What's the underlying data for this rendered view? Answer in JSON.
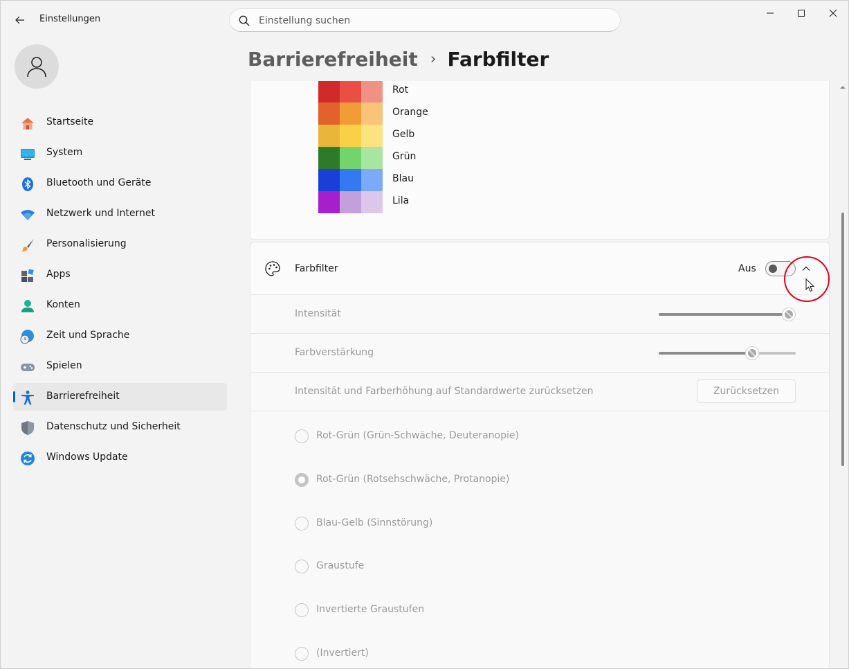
{
  "app": {
    "title": "Einstellungen"
  },
  "search": {
    "placeholder": "Einstellung suchen"
  },
  "sidebar": {
    "items": [
      {
        "label": "Startseite",
        "icon": "home-icon"
      },
      {
        "label": "System",
        "icon": "monitor-icon"
      },
      {
        "label": "Bluetooth und Geräte",
        "icon": "bluetooth-icon"
      },
      {
        "label": "Netzwerk und Internet",
        "icon": "wifi-icon"
      },
      {
        "label": "Personalisierung",
        "icon": "brush-icon"
      },
      {
        "label": "Apps",
        "icon": "apps-icon"
      },
      {
        "label": "Konten",
        "icon": "account-icon"
      },
      {
        "label": "Zeit und Sprache",
        "icon": "globe-clock-icon"
      },
      {
        "label": "Spielen",
        "icon": "gamepad-icon"
      },
      {
        "label": "Barrierefreiheit",
        "icon": "accessibility-icon",
        "active": true
      },
      {
        "label": "Datenschutz und Sicherheit",
        "icon": "shield-icon"
      },
      {
        "label": "Windows Update",
        "icon": "update-icon"
      }
    ]
  },
  "breadcrumb": {
    "parent": "Barrierefreiheit",
    "separator": "›",
    "current": "Farbfilter"
  },
  "swatches": [
    {
      "label": "Rot",
      "colors": [
        "#d02a2a",
        "#eb4e44",
        "#f19186"
      ]
    },
    {
      "label": "Orange",
      "colors": [
        "#e2622a",
        "#f29c38",
        "#f8c47a"
      ]
    },
    {
      "label": "Gelb",
      "colors": [
        "#e9b63a",
        "#f9d047",
        "#fde37f"
      ]
    },
    {
      "label": "Grün",
      "colors": [
        "#2e7a2b",
        "#73d46b",
        "#a6e6a0"
      ]
    },
    {
      "label": "Blau",
      "colors": [
        "#1a3fd6",
        "#3279f2",
        "#7aaaf8"
      ]
    },
    {
      "label": "Lila",
      "colors": [
        "#a61fcc",
        "#c3a0dc",
        "#dcc6ec"
      ]
    }
  ],
  "filter": {
    "title": "Farbfilter",
    "toggle_state": "Aus",
    "toggle_on": false,
    "expanded": true,
    "intensity": {
      "label": "Intensität",
      "value": 0.95
    },
    "boost": {
      "label": "Farbverstärkung",
      "value": 0.68
    },
    "reset": {
      "label": "Intensität und Farberhöhung auf Standardwerte zurücksetzen",
      "button": "Zurücksetzen"
    },
    "options": [
      {
        "label": "Rot-Grün (Grün-Schwäche, Deuteranopie)",
        "checked": false
      },
      {
        "label": "Rot-Grün (Rotsehschwäche, Protanopie)",
        "checked": true
      },
      {
        "label": "Blau-Gelb (Sinnstörung)",
        "checked": false
      },
      {
        "label": "Graustufe",
        "checked": false
      },
      {
        "label": "Invertierte Graustufen",
        "checked": false
      },
      {
        "label": "(Invertiert)",
        "checked": false
      }
    ]
  },
  "colors": {
    "accent": "#0067c0",
    "highlight": "#e0001b"
  }
}
